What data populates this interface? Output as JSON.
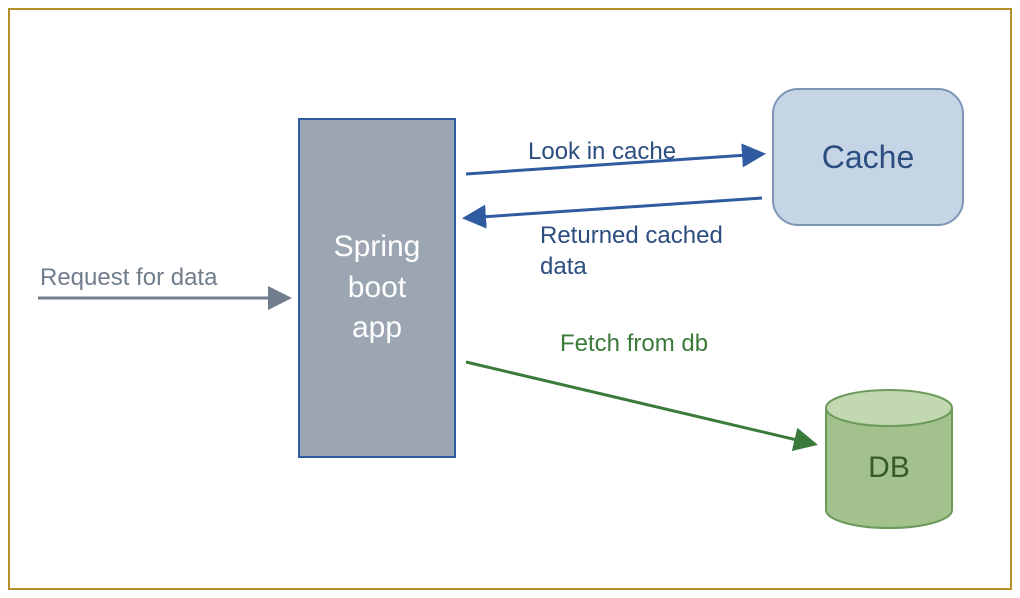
{
  "nodes": {
    "spring": "Spring\nboot\napp",
    "cache": "Cache",
    "db": "DB"
  },
  "edges": {
    "request": "Request for data",
    "look": "Look in cache",
    "returned": "Returned cached data",
    "fetch": "Fetch from db"
  },
  "colors": {
    "frameBorder": "#b58e2e",
    "springFill": "#9ca6b3",
    "springBorder": "#2f5ba0",
    "cacheFill": "#c6d5e6",
    "cacheBorder": "#7d96b6",
    "cacheText": "#2b4d7f",
    "dbFill": "#a2c18c",
    "dbStroke": "#6c9a5a",
    "dbText": "#355b2a",
    "arrowGray": "#6f7d8c",
    "arrowBlue": "#2f5ba0",
    "arrowGreen": "#3a7a3a"
  }
}
